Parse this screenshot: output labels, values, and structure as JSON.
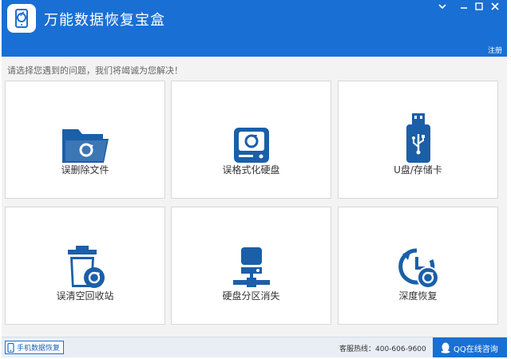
{
  "app": {
    "title": "万能数据恢复宝盒",
    "register_label": "注册"
  },
  "hint": "请选择您遇到的问题，我们将竭诚为您解决！",
  "tiles": [
    {
      "label": "误删除文件",
      "icon": "folder-restore-icon"
    },
    {
      "label": "误格式化硬盘",
      "icon": "hard-drive-refresh-icon"
    },
    {
      "label": "U盘/存储卡",
      "icon": "usb-drive-icon"
    },
    {
      "label": "误清空回收站",
      "icon": "recycle-bin-restore-icon"
    },
    {
      "label": "硬盘分区消失",
      "icon": "disk-partition-icon"
    },
    {
      "label": "深度恢复",
      "icon": "history-restore-icon"
    }
  ],
  "footer": {
    "mobile_label": "手机数据恢复",
    "hotline": "客服热线：400-606-9600",
    "qq_label": "QQ在线咨询"
  },
  "colors": {
    "brand": "#1a6fd4",
    "icon_blue": "#1a5fa8"
  }
}
